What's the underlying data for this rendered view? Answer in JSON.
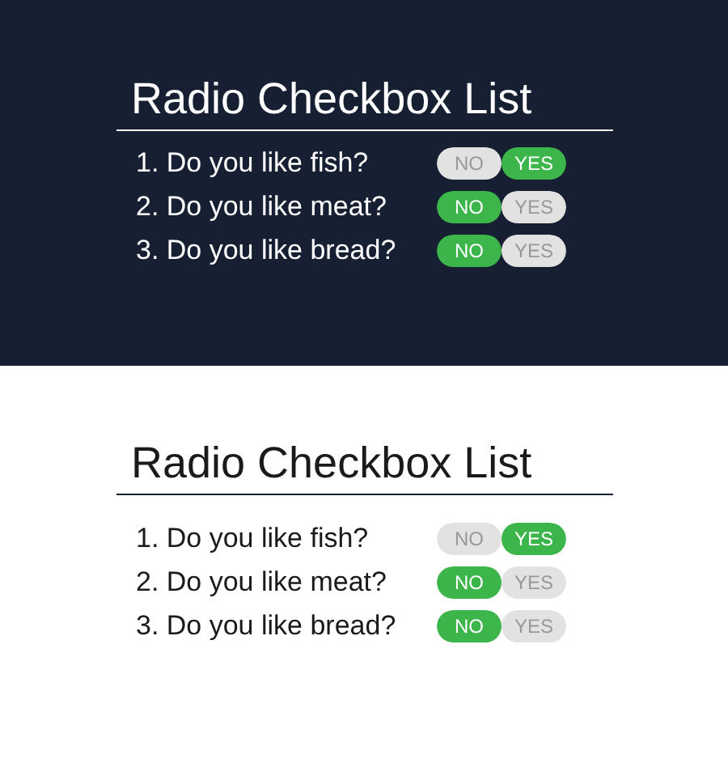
{
  "panels": [
    {
      "kind": "dark",
      "title": "Radio Checkbox List",
      "questions": [
        {
          "text": "1. Do you like fish?",
          "options": [
            {
              "label": "NO",
              "selected": false
            },
            {
              "label": "YES",
              "selected": true
            }
          ]
        },
        {
          "text": "2. Do you like meat?",
          "options": [
            {
              "label": "NO",
              "selected": true
            },
            {
              "label": "YES",
              "selected": false
            }
          ]
        },
        {
          "text": "3. Do you like bread?",
          "options": [
            {
              "label": "NO",
              "selected": true
            },
            {
              "label": "YES",
              "selected": false
            }
          ]
        }
      ]
    },
    {
      "kind": "light",
      "title": "Radio Checkbox List",
      "questions": [
        {
          "text": "1. Do you like fish?",
          "options": [
            {
              "label": "NO",
              "selected": false
            },
            {
              "label": "YES",
              "selected": true
            }
          ]
        },
        {
          "text": "2. Do you like meat?",
          "options": [
            {
              "label": "NO",
              "selected": true
            },
            {
              "label": "YES",
              "selected": false
            }
          ]
        },
        {
          "text": "3. Do you like bread?",
          "options": [
            {
              "label": "NO",
              "selected": true
            },
            {
              "label": "YES",
              "selected": false
            }
          ]
        }
      ]
    }
  ]
}
